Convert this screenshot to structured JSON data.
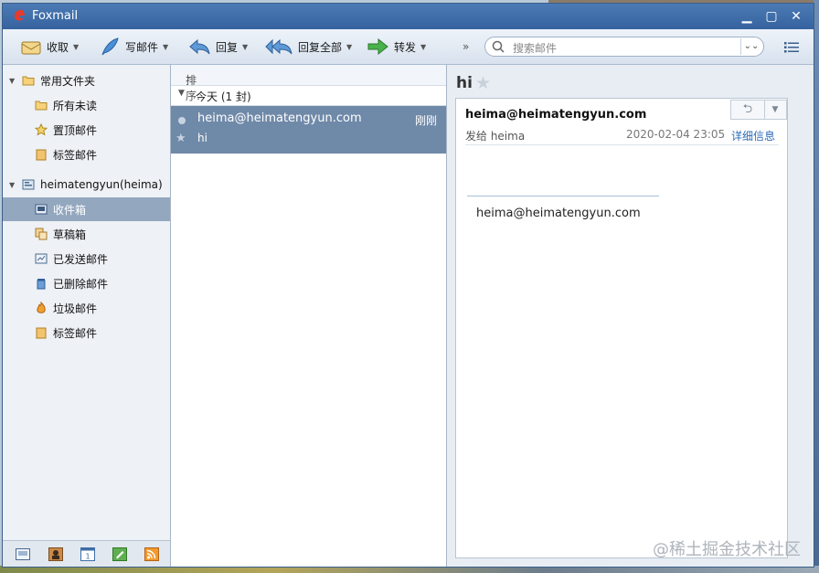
{
  "window": {
    "title": "Foxmail"
  },
  "toolbar": {
    "receive": "收取",
    "compose": "写邮件",
    "reply": "回复",
    "reply_all": "回复全部",
    "forward": "转发",
    "more": "»"
  },
  "search": {
    "placeholder": "搜索邮件"
  },
  "sidebar": {
    "groups": [
      {
        "label": "常用文件夹",
        "icon": "folder-icon"
      },
      {
        "label": "heimatengyun(heima)",
        "icon": "account-icon"
      }
    ],
    "common_items": [
      {
        "label": "所有未读",
        "icon": "folder-icon"
      },
      {
        "label": "置顶邮件",
        "icon": "star-icon"
      },
      {
        "label": "标签邮件",
        "icon": "tag-icon"
      }
    ],
    "account_items": [
      {
        "label": "收件箱",
        "icon": "inbox-icon",
        "selected": true
      },
      {
        "label": "草稿箱",
        "icon": "drafts-icon"
      },
      {
        "label": "已发送邮件",
        "icon": "sent-icon"
      },
      {
        "label": "已删除邮件",
        "icon": "trash-icon"
      },
      {
        "label": "垃圾邮件",
        "icon": "spam-icon"
      },
      {
        "label": "标签邮件",
        "icon": "tag-icon"
      }
    ],
    "bottom_icons": [
      "mail-icon",
      "contacts-icon",
      "calendar-icon",
      "notes-icon",
      "rss-icon"
    ]
  },
  "list": {
    "sort_label": "排序:日期",
    "group_label": "今天 (1 封)",
    "messages": [
      {
        "from": "heima@heimatengyun.com",
        "time": "刚刚",
        "subject": "hi"
      }
    ]
  },
  "reader": {
    "subject": "hi",
    "sender": "heima@heimatengyun.com",
    "to": "发给 heima",
    "date": "2020-02-04 23:05",
    "detail_link": "详细信息",
    "body": "heima@heimatengyun.com"
  },
  "watermark": "@稀土掘金技术社区",
  "colors": {
    "titlebar": "#36639f",
    "selection": "#6f89a8",
    "link": "#2f6bb5"
  }
}
